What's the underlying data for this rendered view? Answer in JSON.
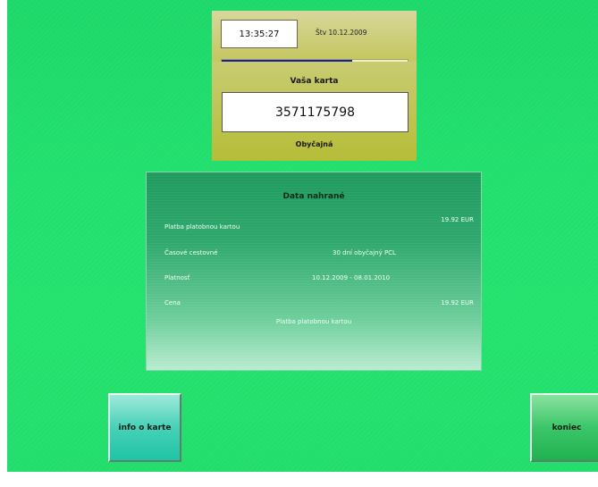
{
  "header": {
    "time": "13:35:27",
    "date": "Štv 10.12.2009",
    "progress_percent": 70
  },
  "card": {
    "title": "Vaša karta",
    "number": "3571175798",
    "type": "Obyčajná"
  },
  "data_panel": {
    "title": "Data nahrané",
    "rows": [
      {
        "label": "Platba platobnou kartou",
        "middle": "",
        "right": "19.92 EUR"
      },
      {
        "label": "Časové cestovné",
        "middle": "30 dní obyčajný PCL",
        "right": ""
      },
      {
        "label": "Platnosť",
        "middle": "10.12.2009 - 08.01.2010",
        "right": ""
      },
      {
        "label": "Cena",
        "middle": "",
        "right": "19.92 EUR"
      }
    ],
    "footer": "Platba platobnou kartou"
  },
  "buttons": {
    "info": "info o karte",
    "end": "koniec"
  },
  "colors": {
    "background": "#22e06e",
    "card_panel": "#b5bd38",
    "progress_fill": "#1a1f9a",
    "data_panel": "#2ea86c",
    "info_button": "#46d1b8",
    "end_button": "#3cc66a"
  }
}
